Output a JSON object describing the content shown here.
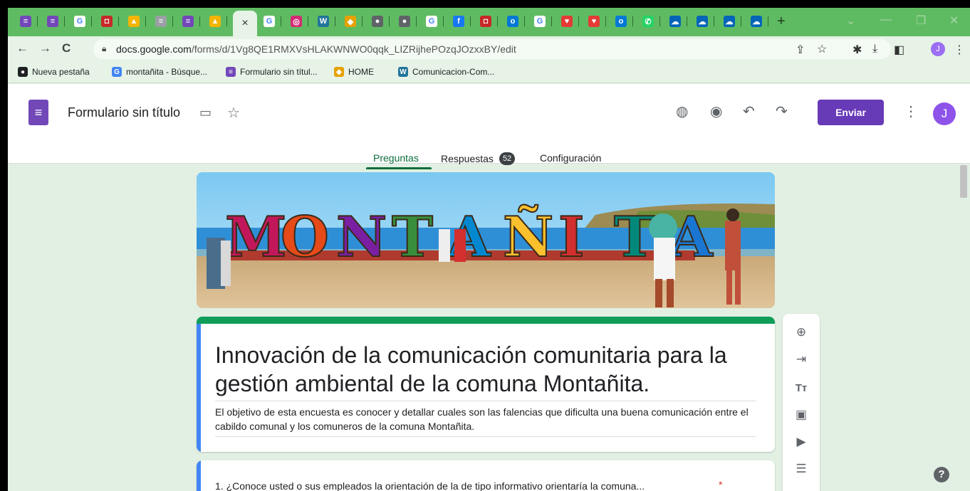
{
  "browser": {
    "tabs": [
      {
        "icon": "google-forms-icon",
        "color": "#7248b9",
        "glyph": "≡"
      },
      {
        "icon": "google-forms-icon",
        "color": "#7248b9",
        "glyph": "≡"
      },
      {
        "icon": "google-icon",
        "color": "#ffffff",
        "glyph": "G"
      },
      {
        "icon": "red-app-icon",
        "color": "#c62828",
        "glyph": "◘"
      },
      {
        "icon": "google-drive-icon",
        "color": "#f4b400",
        "glyph": "▲"
      },
      {
        "icon": "doc-icon",
        "color": "#9aa0a6",
        "glyph": "≡"
      },
      {
        "icon": "google-forms-icon",
        "color": "#7248b9",
        "glyph": "≡"
      },
      {
        "icon": "google-drive-icon",
        "color": "#f4b400",
        "glyph": "▲"
      },
      {
        "icon": "google-icon",
        "color": "#ffffff",
        "glyph": "G"
      },
      {
        "icon": "instagram-icon",
        "color": "#d62976",
        "glyph": "◎"
      },
      {
        "icon": "wordpress-icon",
        "color": "#21759b",
        "glyph": "W"
      },
      {
        "icon": "app-icon",
        "color": "#e6a100",
        "glyph": "◆"
      },
      {
        "icon": "globe-icon",
        "color": "#5f6368",
        "glyph": "●"
      },
      {
        "icon": "globe-icon",
        "color": "#5f6368",
        "glyph": "●"
      },
      {
        "icon": "google-icon",
        "color": "#ffffff",
        "glyph": "G"
      },
      {
        "icon": "facebook-icon",
        "color": "#1877f2",
        "glyph": "f"
      },
      {
        "icon": "red-app-icon",
        "color": "#c62828",
        "glyph": "◘"
      },
      {
        "icon": "outlook-icon",
        "color": "#0078d4",
        "glyph": "o"
      },
      {
        "icon": "google-icon",
        "color": "#ffffff",
        "glyph": "G"
      },
      {
        "icon": "heart-icon",
        "color": "#e53935",
        "glyph": "♥"
      },
      {
        "icon": "heart-icon",
        "color": "#e53935",
        "glyph": "♥"
      },
      {
        "icon": "outlook-icon",
        "color": "#0078d4",
        "glyph": "o"
      },
      {
        "icon": "whatsapp-icon",
        "color": "#25d366",
        "glyph": "✆"
      },
      {
        "icon": "onedrive-icon",
        "color": "#0364b8",
        "glyph": "☁"
      },
      {
        "icon": "onedrive-icon",
        "color": "#0364b8",
        "glyph": "☁"
      },
      {
        "icon": "onedrive-icon",
        "color": "#0364b8",
        "glyph": "☁"
      },
      {
        "icon": "onedrive-icon",
        "color": "#0364b8",
        "glyph": "☁"
      }
    ],
    "active_tab_close": "×",
    "new_tab": "+",
    "url_host": "docs.google.com",
    "url_path": "/forms/d/1Vg8QE1RMXVsHLAKWNWO0qqk_LIZRijhePOzqJOzxxBY/edit",
    "profile_initial": "J"
  },
  "bookmarks": [
    {
      "label": "Nueva pestaña",
      "icon": "globe-icon",
      "color": "#202124",
      "glyph": "●"
    },
    {
      "label": "montañita - Búsque...",
      "icon": "google-icon",
      "color": "#4285f4",
      "glyph": "G"
    },
    {
      "label": "Formulario sin títul...",
      "icon": "google-forms-icon",
      "color": "#7248b9",
      "glyph": "≡"
    },
    {
      "label": "HOME",
      "icon": "home-icon",
      "color": "#e6a100",
      "glyph": "◆"
    },
    {
      "label": "Comunicacion-Com...",
      "icon": "wordpress-icon",
      "color": "#21759b",
      "glyph": "W"
    }
  ],
  "header": {
    "doc_title": "Formulario sin título",
    "send_label": "Enviar",
    "avatar_initial": "J",
    "tabs": {
      "questions": "Preguntas",
      "responses": "Respuestas",
      "responses_count": "52",
      "settings": "Configuración"
    }
  },
  "banner": {
    "letters": [
      "M",
      "O",
      "N",
      "T",
      "A",
      "Ñ",
      "I",
      "T",
      "A"
    ]
  },
  "form": {
    "title": "Innovación de la comunicación comunitaria para la gestión ambiental de la comuna Montañita.",
    "description": "El objetivo de esta encuesta es conocer y detallar cuales son las falencias que dificulta una buena comunicación entre el cabildo comunal y los comuneros de la comuna Montañita.",
    "question_1": "1. ¿Conoce usted o sus empleados la orientación de la de tipo informativo orientaría la comuna...",
    "required_mark": "*"
  },
  "colors": {
    "accent": "#673ab7",
    "tab_active": "#0f6e3c",
    "card_top": "#0f9d58",
    "card_left": "#4285f4",
    "page_bg": "#e2f0e3"
  }
}
